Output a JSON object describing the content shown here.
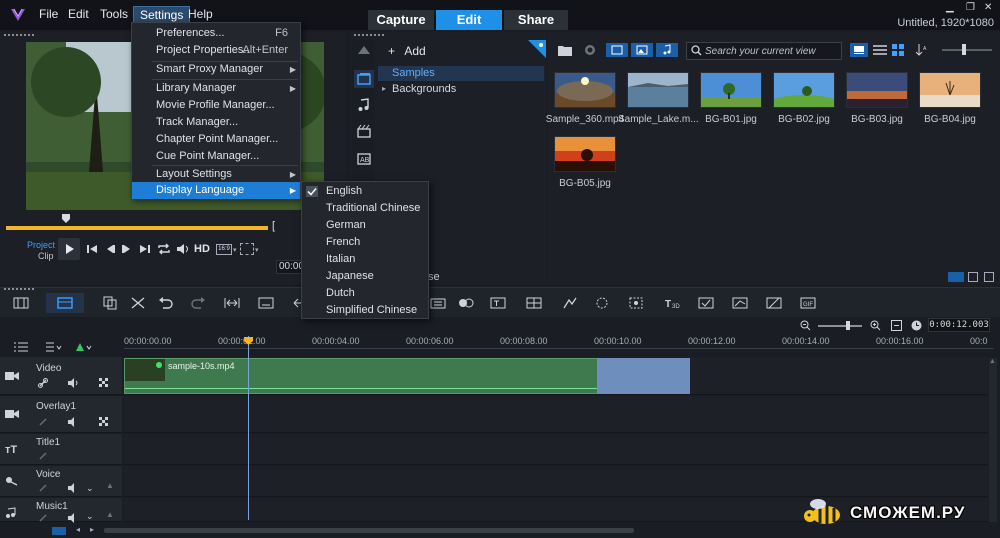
{
  "app": {
    "title_right": "Untitled, 1920*1080",
    "menus": [
      "File",
      "Edit",
      "Tools",
      "Settings",
      "Help"
    ],
    "workspace_tabs": [
      "Capture",
      "Edit",
      "Share"
    ]
  },
  "settings_menu": {
    "items": [
      {
        "label": "Preferences...",
        "shortcut": "F6"
      },
      {
        "label": "Project Properties...",
        "shortcut": "Alt+Enter"
      },
      {
        "label": "Smart Proxy Manager",
        "submenu": true
      },
      {
        "label": "Library Manager",
        "submenu": true
      },
      {
        "label": "Movie Profile Manager..."
      },
      {
        "label": "Track Manager..."
      },
      {
        "label": "Chapter Point Manager..."
      },
      {
        "label": "Cue Point Manager..."
      },
      {
        "label": "Layout Settings",
        "submenu": true
      },
      {
        "label": "Display Language",
        "submenu": true
      }
    ]
  },
  "language_menu": {
    "items": [
      "English",
      "Traditional Chinese",
      "German",
      "French",
      "Italian",
      "Japanese",
      "Dutch",
      "Simplified Chinese"
    ],
    "checked": "English"
  },
  "player": {
    "project_label": "Project",
    "clip_label": "Clip",
    "hd_label": "HD",
    "aspect_label": "16:9",
    "timecode": "00:00"
  },
  "library": {
    "add_label": "Add",
    "samples_label": "Samples",
    "backgrounds_label": "Backgrounds",
    "partial_label": "se",
    "search_placeholder": "Search your current view",
    "thumbnails": [
      "Sample_360.mp4",
      "Sample_Lake.m...",
      "BG-B01.jpg",
      "BG-B02.jpg",
      "BG-B03.jpg",
      "BG-B04.jpg",
      "BG-B05.jpg"
    ]
  },
  "timeline": {
    "ruler_ticks": [
      "00:00:00.00",
      "00:00:02.00",
      "00:00:04.00",
      "00:00:06.00",
      "00:00:08.00",
      "00:00:10.00",
      "00:00:12.00",
      "00:00:14.00",
      "00:00:16.00",
      "00:0"
    ],
    "timecode": "0:00:12.003",
    "tracks": [
      "Video",
      "Overlay1",
      "Title1",
      "Voice",
      "Music1"
    ],
    "clip_name": "sample-10s.mp4"
  },
  "watermark": "СМОЖЕМ.РУ",
  "colors": {
    "accent": "#1e90e6",
    "clip_green": "#3f7a4f",
    "clip_blue": "#6e8fbd"
  }
}
